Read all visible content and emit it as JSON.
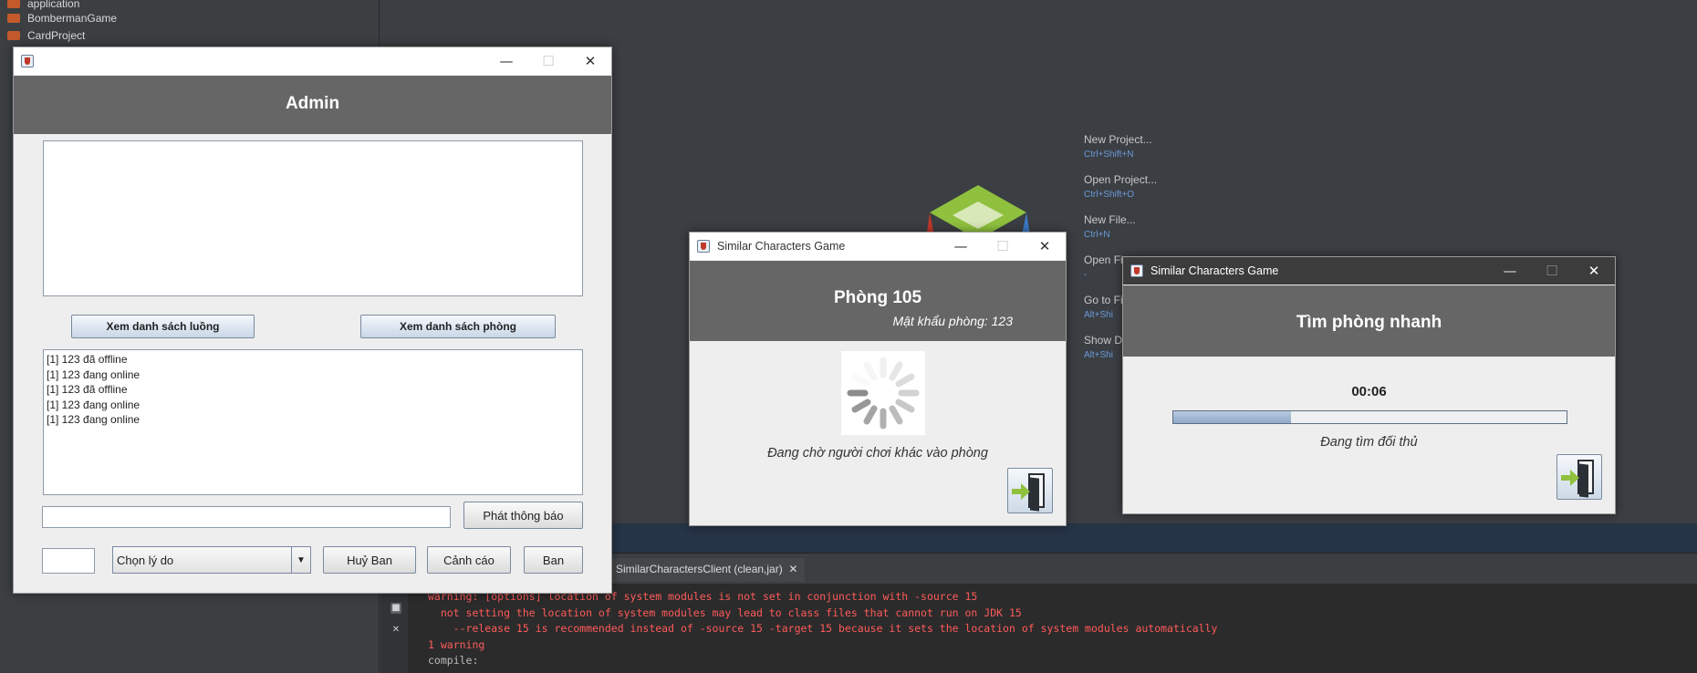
{
  "ide": {
    "projects": [
      "application",
      "BombermanGame",
      "CardProject"
    ],
    "start_links": [
      {
        "label": "New Project...",
        "shortcut": "Ctrl+Shift+N"
      },
      {
        "label": "Open Project...",
        "shortcut": "Ctrl+Shift+O"
      },
      {
        "label": "New File...",
        "shortcut": "Ctrl+N"
      },
      {
        "label": "Open Fi",
        "shortcut": "-"
      },
      {
        "label": "Go to Fi",
        "shortcut": "Alt+Shi"
      },
      {
        "label": "Show D",
        "shortcut": "Alt+Shi"
      }
    ],
    "output_tab": "SimilarCharactersClient (clean,jar)",
    "output_tab_close": "✕",
    "console_lines": [
      "warning: [options] location of system modules is not set in conjunction with -source 15",
      "  not setting the location of system modules may lead to class files that cannot run on JDK 15",
      "    --release 15 is recommended instead of -source 15 -target 15 because it sets the location of system modules automatically",
      "1 warning",
      "compile:"
    ]
  },
  "admin": {
    "title": "Admin",
    "btn_threads": "Xem danh sách luồng",
    "btn_rooms": "Xem danh sách phòng",
    "log_lines": [
      "[1] 123 đã offline",
      "[1] 123 đang online",
      "[1] 123 đã offline",
      "[1] 123 đang online",
      "[1] 123 đang online"
    ],
    "broadcast_value": "",
    "btn_broadcast": "Phát thông báo",
    "id_value": "",
    "reason_select": "Chọn lý do",
    "btn_unban": "Huỷ Ban",
    "btn_warn": "Cảnh cáo",
    "btn_ban": "Ban"
  },
  "room_window": {
    "window_title": "Similar Characters Game",
    "room_title": "Phòng 105",
    "room_password": "Mật khẩu phòng: 123",
    "waiting_message": "Đang chờ người chơi khác vào phòng"
  },
  "quick_window": {
    "window_title": "Similar Characters Game",
    "header": "Tìm phòng nhanh",
    "timer": "00:06",
    "progress": 0.3,
    "status": "Đang tìm đối thủ"
  },
  "controls": {
    "minimize": "—",
    "maximize": "☐",
    "close": "✕"
  },
  "colors": {
    "header_gray": "#666666",
    "console_error": "#ff5a5a",
    "progress_fill": "#8ea9c8"
  }
}
